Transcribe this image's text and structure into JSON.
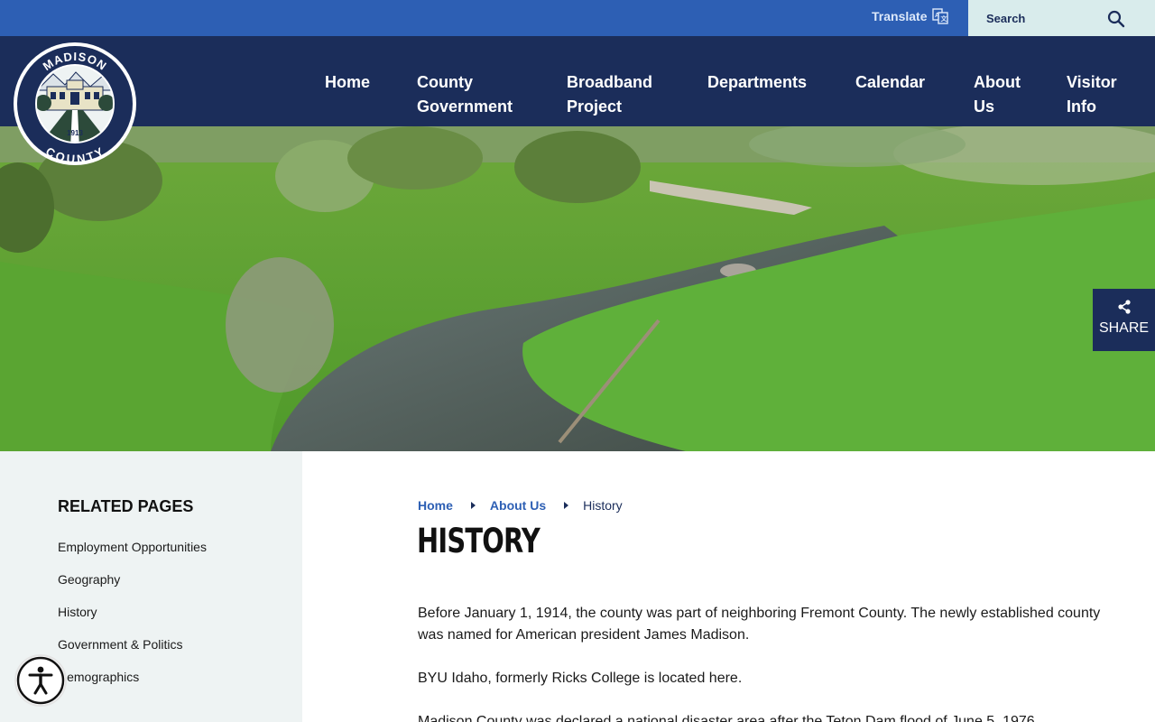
{
  "topbar": {
    "translate_label": "Translate",
    "search_placeholder": "Search"
  },
  "logo": {
    "top_text": "MADISON",
    "bottom_text": "COUNTY",
    "year": "1913"
  },
  "nav": {
    "items": [
      {
        "line1": "Home",
        "line2": ""
      },
      {
        "line1": "County",
        "line2": "Government"
      },
      {
        "line1": "Broadband",
        "line2": "Project"
      },
      {
        "line1": "Departments",
        "line2": ""
      },
      {
        "line1": "Calendar",
        "line2": ""
      },
      {
        "line1": "About",
        "line2": "Us"
      },
      {
        "line1": "Visitor",
        "line2": "Info"
      }
    ]
  },
  "share": {
    "label": "SHARE"
  },
  "sidebar": {
    "title": "RELATED PAGES",
    "items": [
      "Employment Opportunities",
      "Geography",
      "History",
      "Government & Politics",
      "Demographics"
    ]
  },
  "breadcrumb": {
    "home": "Home",
    "parent": "About Us",
    "current": "History"
  },
  "page": {
    "title": "HISTORY",
    "paragraphs": [
      "Before January 1, 1914, the county was part of neighboring Fremont County. The newly established county was named for American president James Madison.",
      "BYU Idaho, formerly Ricks College is located here.",
      "Madison County was declared a national disaster area after the Teton Dam flood of June 5, 1976."
    ]
  },
  "colors": {
    "topbar": "#2d5fb4",
    "navbar": "#1b2d5a",
    "search_bg": "#d9ecec",
    "sidebar_bg": "#eef3f3",
    "link": "#2d5fb4"
  }
}
